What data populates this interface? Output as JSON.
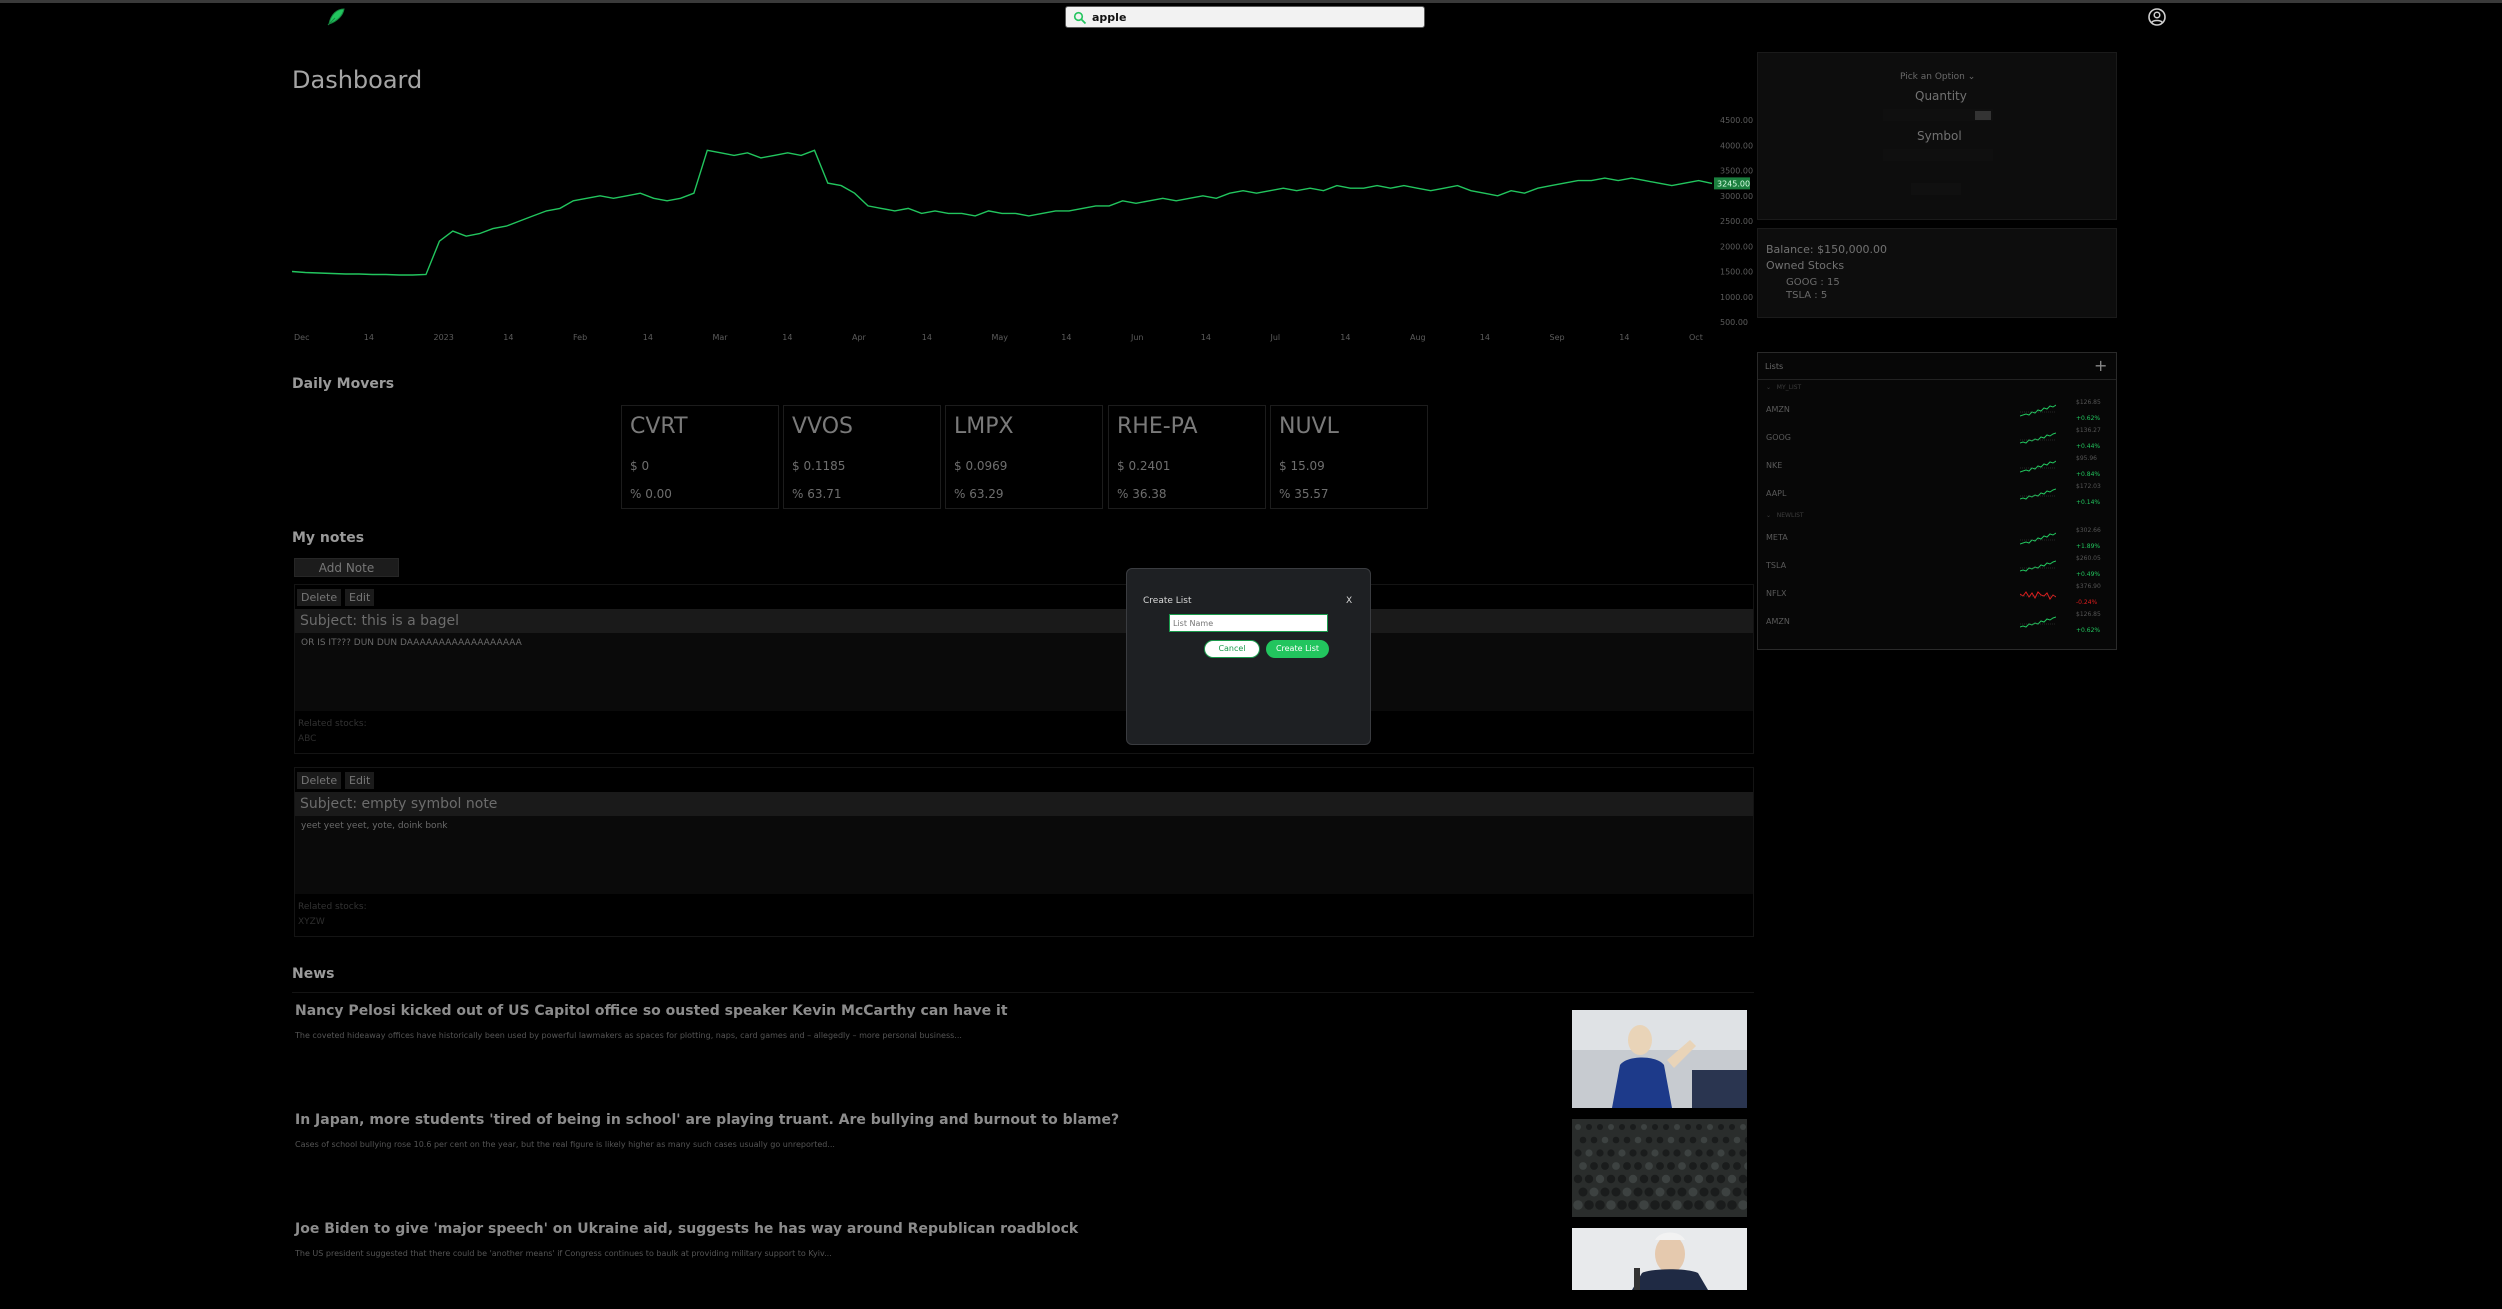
{
  "search": {
    "value": "apple"
  },
  "dashboard": {
    "title": "Dashboard"
  },
  "chart_data": {
    "type": "line",
    "x_ticks": [
      "Dec",
      "14",
      "2023",
      "14",
      "Feb",
      "14",
      "Mar",
      "14",
      "Apr",
      "14",
      "May",
      "14",
      "Jun",
      "14",
      "Jul",
      "14",
      "Aug",
      "14",
      "Sep",
      "14",
      "Oct"
    ],
    "y_ticks": [
      "4500.00",
      "4000.00",
      "3500.00",
      "3000.00",
      "2500.00",
      "2000.00",
      "1500.00",
      "1000.00",
      "500.00"
    ],
    "ylim": [
      500,
      4500
    ],
    "last_value_label": "3245.00",
    "color": "#22c55e",
    "values": [
      1500,
      1480,
      1470,
      1460,
      1450,
      1450,
      1440,
      1440,
      1430,
      1430,
      1440,
      2100,
      2300,
      2200,
      2250,
      2350,
      2400,
      2500,
      2600,
      2700,
      2750,
      2900,
      2950,
      3000,
      2950,
      3000,
      3050,
      2950,
      2900,
      2950,
      3050,
      3900,
      3850,
      3800,
      3850,
      3750,
      3800,
      3850,
      3800,
      3900,
      3250,
      3200,
      3050,
      2800,
      2750,
      2700,
      2750,
      2650,
      2700,
      2650,
      2650,
      2600,
      2700,
      2650,
      2650,
      2600,
      2650,
      2700,
      2700,
      2750,
      2800,
      2800,
      2900,
      2850,
      2900,
      2950,
      2900,
      2950,
      3000,
      2950,
      3050,
      3100,
      3050,
      3100,
      3150,
      3100,
      3150,
      3100,
      3200,
      3150,
      3150,
      3200,
      3150,
      3200,
      3150,
      3100,
      3150,
      3200,
      3100,
      3050,
      3000,
      3100,
      3050,
      3150,
      3200,
      3250,
      3300,
      3300,
      3350,
      3300,
      3350,
      3300,
      3250,
      3200,
      3250,
      3300,
      3245
    ]
  },
  "movers": {
    "heading": "Daily Movers",
    "items": [
      {
        "symbol": "CVRT",
        "price": "$ 0",
        "pct": "% 0.00"
      },
      {
        "symbol": "VVOS",
        "price": "$ 0.1185",
        "pct": "% 63.71"
      },
      {
        "symbol": "LMPX",
        "price": "$ 0.0969",
        "pct": "% 63.29"
      },
      {
        "symbol": "RHE-PA",
        "price": "$ 0.2401",
        "pct": "% 36.38"
      },
      {
        "symbol": "NUVL",
        "price": "$ 15.09",
        "pct": "% 35.57"
      }
    ]
  },
  "notes": {
    "heading": "My notes",
    "add_label": "Add Note",
    "delete_label": "Delete",
    "edit_label": "Edit",
    "related_label": "Related stocks:",
    "items": [
      {
        "subject": "Subject: this is a bagel",
        "body": "OR IS IT??? DUN DUN DAAAAAAAAAAAAAAAAAA",
        "related": "ABC"
      },
      {
        "subject": "Subject: empty symbol note",
        "body": "yeet yeet yeet, yote, doink bonk",
        "related": "XYZW"
      }
    ]
  },
  "news": {
    "heading": "News",
    "items": [
      {
        "title": "Nancy Pelosi kicked out of US Capitol office so ousted speaker Kevin McCarthy can have it",
        "desc": "The coveted hideaway offices have historically been used by powerful lawmakers as spaces for plotting, naps, card games and – allegedly – more personal business..."
      },
      {
        "title": "In Japan, more students 'tired of being in school' are playing truant. Are bullying and burnout to blame?",
        "desc": "Cases of school bullying rose 10.6 per cent on the year, but the real figure is likely higher as many such cases usually go unreported..."
      },
      {
        "title": "Joe Biden to give 'major speech' on Ukraine aid, suggests he has way around Republican roadblock",
        "desc": "The US president suggested that there could be 'another means' if Congress continues to baulk at providing military support to Kyiv..."
      }
    ]
  },
  "order": {
    "pick_label": "Pick an Option",
    "quantity_label": "Quantity",
    "symbol_label": "Symbol"
  },
  "account": {
    "balance": "Balance: $150,000.00",
    "owned_label": "Owned Stocks",
    "owned": [
      "GOOG : 15",
      "TSLA : 5"
    ]
  },
  "lists": {
    "title": "Lists",
    "add_symbol": "+",
    "sections": [
      {
        "name": "MY_LIST",
        "rows": [
          {
            "symbol": "AMZN",
            "price": "$126.85",
            "change": "+0.62%",
            "up": true
          },
          {
            "symbol": "GOOG",
            "price": "$136.27",
            "change": "+0.44%",
            "up": true
          },
          {
            "symbol": "NKE",
            "price": "$95.96",
            "change": "+0.84%",
            "up": true
          },
          {
            "symbol": "AAPL",
            "price": "$172.03",
            "change": "+0.14%",
            "up": true
          }
        ]
      },
      {
        "name": "NEWLIST",
        "rows": [
          {
            "symbol": "META",
            "price": "$302.66",
            "change": "+1.89%",
            "up": true
          },
          {
            "symbol": "TSLA",
            "price": "$260.05",
            "change": "+0.49%",
            "up": true
          },
          {
            "symbol": "NFLX",
            "price": "$376.90",
            "change": "-0.24%",
            "up": false
          },
          {
            "symbol": "AMZN",
            "price": "$126.85",
            "change": "+0.62%",
            "up": true
          }
        ]
      }
    ]
  },
  "modal": {
    "title": "Create List",
    "close": "X",
    "placeholder": "List Name",
    "cancel": "Cancel",
    "create": "Create List"
  },
  "colors": {
    "accent": "#22c55e",
    "negative": "#e11d1d"
  }
}
